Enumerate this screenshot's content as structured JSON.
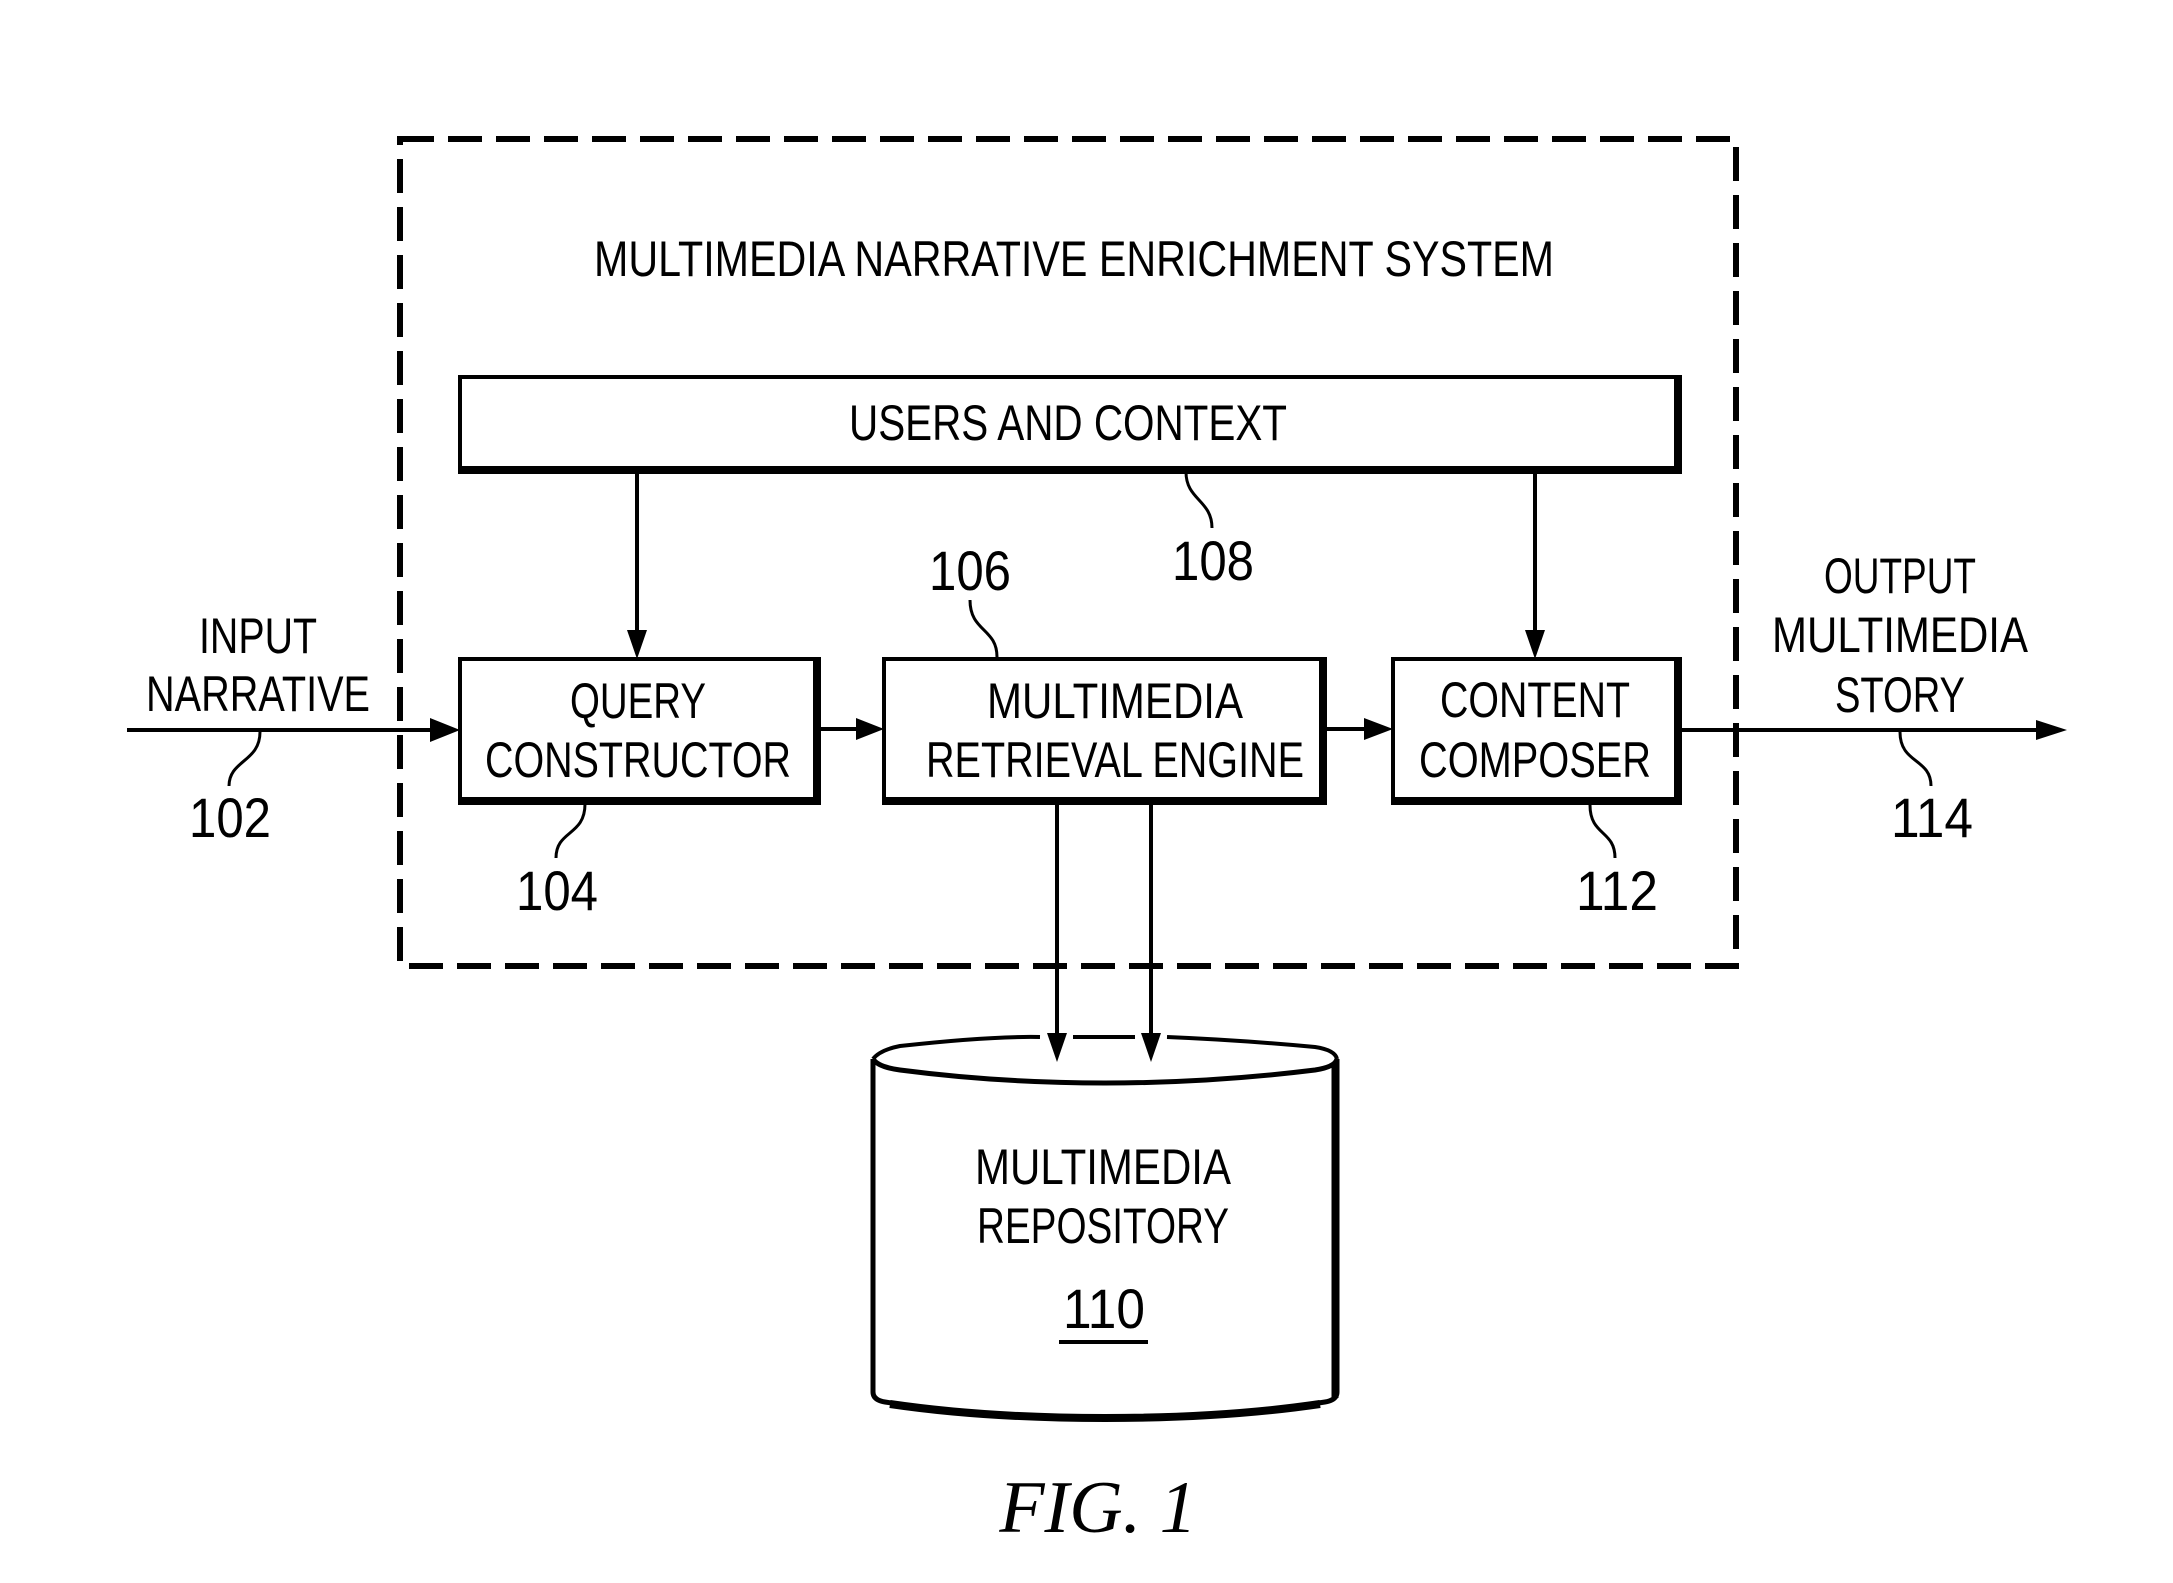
{
  "figure": {
    "caption": "FIG. 1",
    "system": {
      "title": "MULTIMEDIA NARRATIVE ENRICHMENT SYSTEM"
    },
    "blocks": {
      "users_context": {
        "lines": [
          "USERS AND CONTEXT"
        ],
        "ref": "108"
      },
      "query_constructor": {
        "lines": [
          "QUERY",
          "CONSTRUCTOR"
        ],
        "ref": "104"
      },
      "retrieval_engine": {
        "lines": [
          "MULTIMEDIA",
          "RETRIEVAL ENGINE"
        ],
        "ref": "106"
      },
      "content_composer": {
        "lines": [
          "CONTENT",
          "COMPOSER"
        ],
        "ref": "112"
      },
      "repository": {
        "lines": [
          "MULTIMEDIA",
          "REPOSITORY"
        ],
        "ref": "110",
        "shape": "database-cylinder-icon"
      }
    },
    "input": {
      "lines": [
        "INPUT",
        "NARRATIVE"
      ],
      "ref": "102"
    },
    "output": {
      "lines": [
        "OUTPUT",
        "MULTIMEDIA",
        "STORY"
      ],
      "ref": "114"
    },
    "connections": [
      {
        "from": "input",
        "to": "query_constructor"
      },
      {
        "from": "users_context",
        "to": "query_constructor"
      },
      {
        "from": "users_context",
        "to": "content_composer"
      },
      {
        "from": "query_constructor",
        "to": "retrieval_engine"
      },
      {
        "from": "retrieval_engine",
        "to": "content_composer"
      },
      {
        "from": "retrieval_engine",
        "to": "repository"
      },
      {
        "from": "retrieval_engine",
        "to": "repository"
      },
      {
        "from": "content_composer",
        "to": "output"
      }
    ]
  }
}
